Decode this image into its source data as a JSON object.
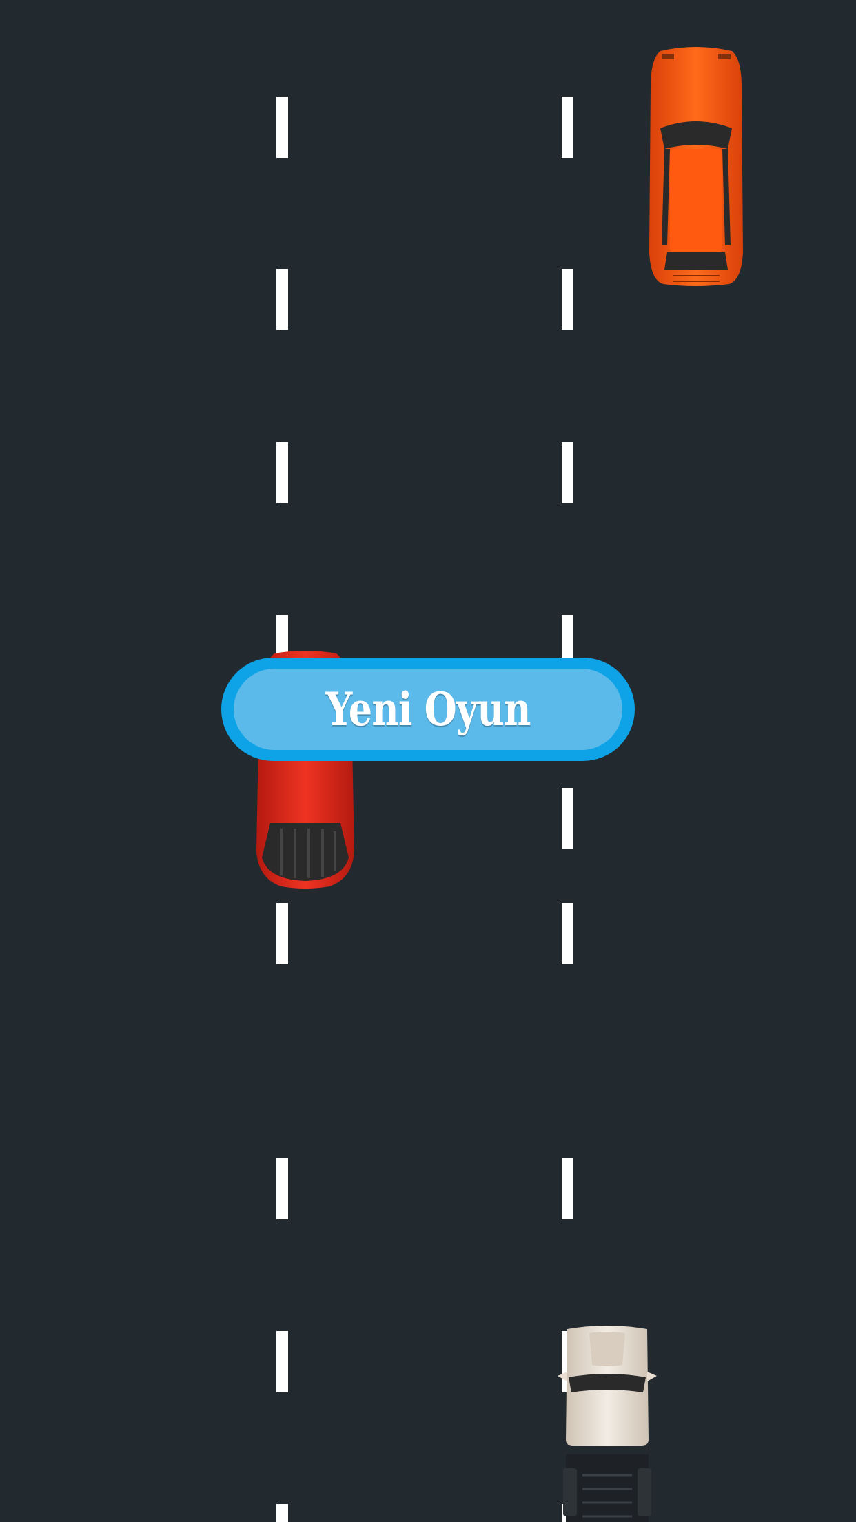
{
  "game": {
    "new_game_button_label": "Yeni Oyun"
  },
  "colors": {
    "road": "#222a30",
    "lane_marking": "#ffffff",
    "button_outer": "#0da3e6",
    "button_inner": "#5cbaea",
    "player_car": "#e8261c",
    "opponent_car_orange": "#ff5a0f",
    "opponent_truck": "#e8ddd0"
  },
  "icons": {
    "player": "red-pickup-car-icon",
    "opponent_1": "orange-sports-car-icon",
    "opponent_2": "white-truck-icon"
  }
}
